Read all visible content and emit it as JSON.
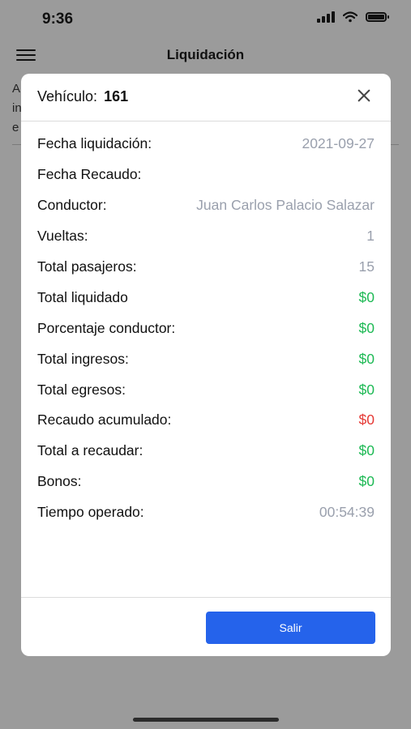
{
  "status_bar": {
    "time": "9:36"
  },
  "nav": {
    "title": "Liquidación"
  },
  "background_text": {
    "line1": "A",
    "line2": "in",
    "line3": "e"
  },
  "modal": {
    "vehicle_label": "Vehículo:",
    "vehicle_number": "161",
    "rows": [
      {
        "label": "Fecha liquidación:",
        "value": "2021-09-27",
        "color": "#9aa0ad"
      },
      {
        "label": "Fecha Recaudo:",
        "value": "",
        "color": "#9aa0ad"
      },
      {
        "label": "Conductor:",
        "value": "Juan Carlos Palacio Salazar",
        "color": "#9aa0ad"
      },
      {
        "label": "Vueltas:",
        "value": "1",
        "color": "#9aa0ad"
      },
      {
        "label": "Total pasajeros:",
        "value": "15",
        "color": "#9aa0ad"
      },
      {
        "label": "Total liquidado",
        "value": "$0",
        "color": "#1db954"
      },
      {
        "label": "Porcentaje conductor:",
        "value": "$0",
        "color": "#1db954"
      },
      {
        "label": "Total ingresos:",
        "value": "$0",
        "color": "#1db954"
      },
      {
        "label": "Total egresos:",
        "value": "$0",
        "color": "#1db954"
      },
      {
        "label": "Recaudo acumulado:",
        "value": "$0",
        "color": "#e53935"
      },
      {
        "label": "Total a recaudar:",
        "value": "$0",
        "color": "#1db954"
      },
      {
        "label": "Bonos:",
        "value": "$0",
        "color": "#1db954"
      },
      {
        "label": "Tiempo operado:",
        "value": "00:54:39",
        "color": "#9aa0ad"
      }
    ],
    "exit_button": "Salir"
  },
  "colors": {
    "accent": "#2563eb",
    "positive": "#1db954",
    "negative": "#e53935",
    "muted": "#9aa0ad"
  },
  "icons": {
    "menu": "hamburger-icon",
    "close": "close-icon",
    "wifi": "wifi-icon",
    "battery": "battery-icon",
    "signal": "signal-icon"
  }
}
